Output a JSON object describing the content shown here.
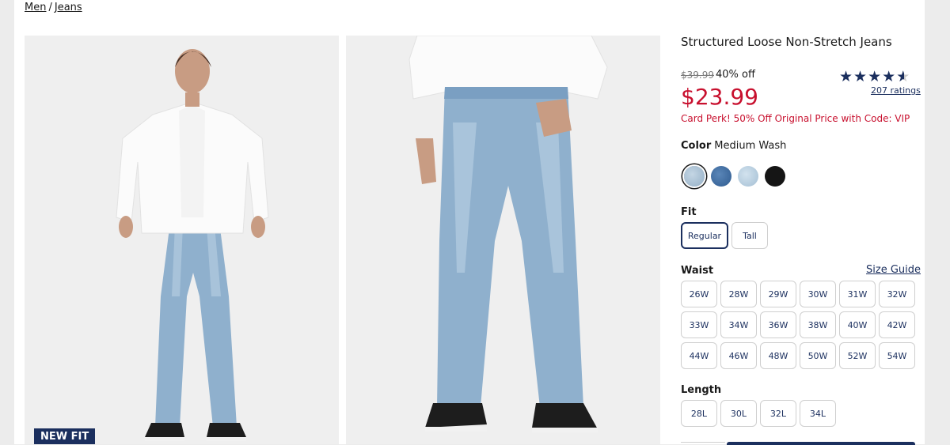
{
  "breadcrumb": {
    "parent": "Men",
    "separator": "/",
    "current": "Jeans"
  },
  "gallery": {
    "badge": "NEW FIT"
  },
  "product": {
    "title": "Structured Loose Non-Stretch Jeans",
    "original_price": "$39.99",
    "discount": "40% off",
    "price": "$23.99",
    "rating": 4.5,
    "ratings_link": "207 ratings",
    "promo": "Card Perk! 50% Off Original Price with Code: VIP"
  },
  "color": {
    "label": "Color",
    "selected": "Medium Wash",
    "swatches": [
      {
        "name": "medium-wash",
        "hex": "#a9bfd2",
        "selected": true
      },
      {
        "name": "dark-wash",
        "hex": "#3e6da3",
        "selected": false
      },
      {
        "name": "light-wash",
        "hex": "#b7cfe0",
        "selected": false
      },
      {
        "name": "black",
        "hex": "#151515",
        "selected": false
      }
    ]
  },
  "fit": {
    "label": "Fit",
    "options": [
      "Regular",
      "Tall"
    ],
    "selected": "Regular"
  },
  "waist": {
    "label": "Waist",
    "size_guide": "Size Guide",
    "options": [
      "26W",
      "28W",
      "29W",
      "30W",
      "31W",
      "32W",
      "33W",
      "34W",
      "36W",
      "38W",
      "40W",
      "42W",
      "44W",
      "46W",
      "48W",
      "50W",
      "52W",
      "54W"
    ]
  },
  "length": {
    "label": "Length",
    "options": [
      "28L",
      "30L",
      "32L",
      "34L"
    ]
  },
  "colors": {
    "brand_navy": "#1b2f5e",
    "sale_red": "#c8102e"
  }
}
